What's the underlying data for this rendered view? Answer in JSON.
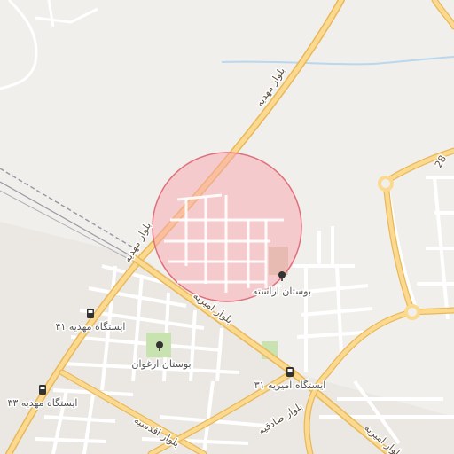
{
  "map": {
    "colors": {
      "background": "#f1efeb",
      "urban_area": "#ebe8e3",
      "major_road_fill": "#fbd98f",
      "major_road_casing": "#e8b95c",
      "minor_road": "#ffffff",
      "railway": "#9a9aa6",
      "waterway": "#b9d7ee",
      "park": "#c8e3b0",
      "highlight_fill": "#f7a5ad",
      "highlight_stroke": "#e0707c"
    },
    "road_labels": {
      "bolvar_mahdieh": "بلوار مهدیه",
      "bolvar_amirieh": "بلوار امیریه",
      "bolvar_aghdasieh": "بلوار اقدسیه",
      "bolvar_sadeghieh": "بلوار صادقیه",
      "road_28": "28",
      "bolvar_amirieh_2": "بلوار امیریه"
    },
    "poi": {
      "bostan_arasteh": "بوستان آراسته",
      "bostan_arghavan": "بوستان ارغوان",
      "istgah_mahdieh_41": "ایستگاه مهدیه ۴۱",
      "istgah_amirieh_31": "ایستگاه امیریه ۳۱",
      "istgah_mahdieh_33": "ایستگاه مهدیه ۳۳"
    },
    "icons": {
      "bus_stop": "bus-stop-icon",
      "park": "tree-icon"
    }
  }
}
